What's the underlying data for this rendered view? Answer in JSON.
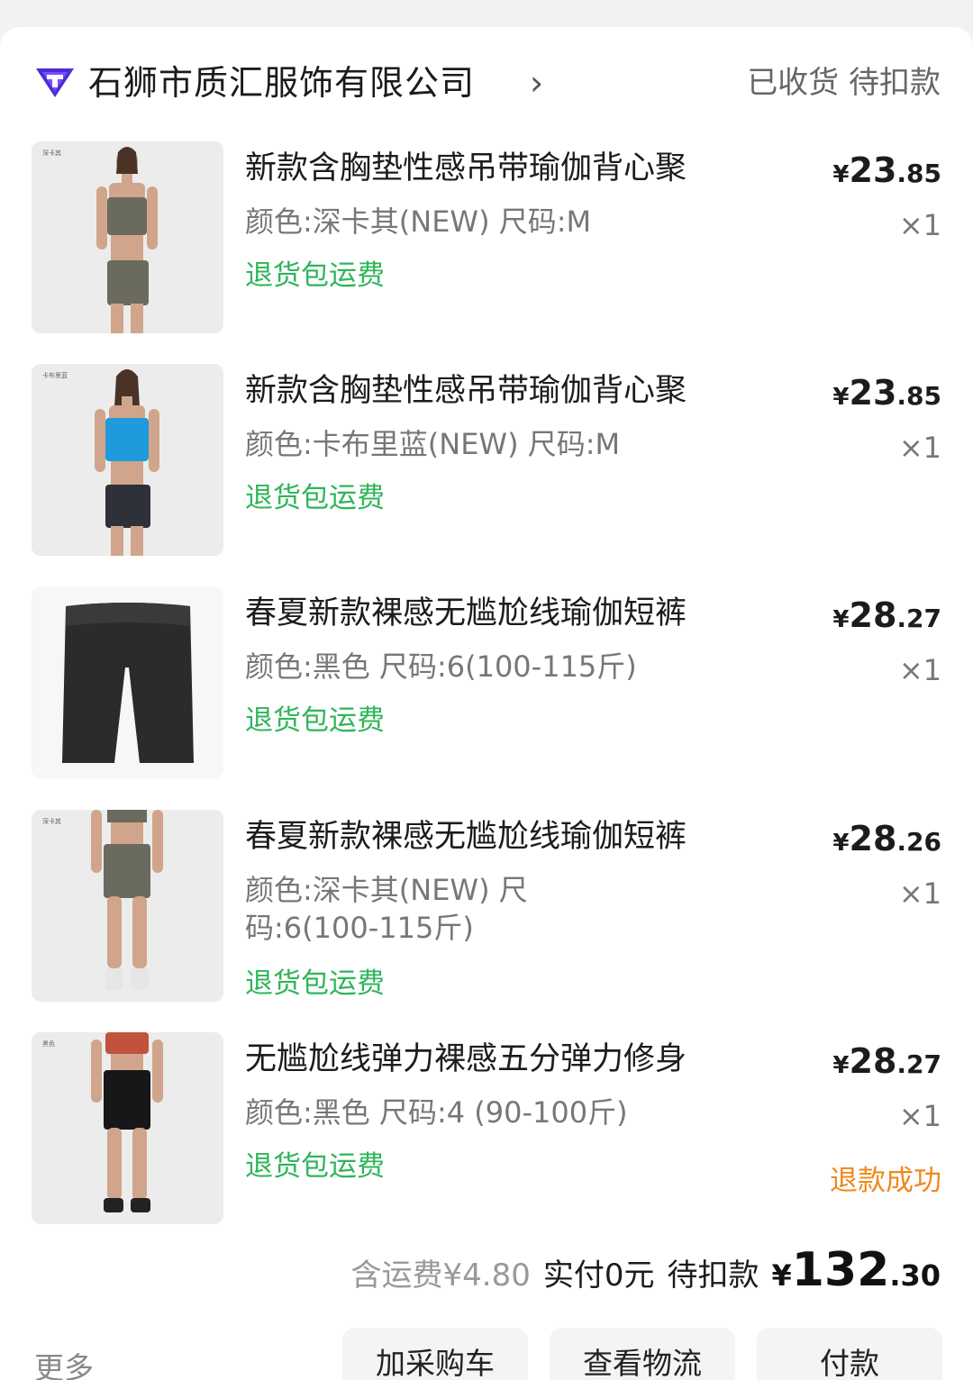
{
  "shop": {
    "name": "石狮市质汇服饰有限公司",
    "status": "已收货 待扣款",
    "brand_color": "#4a2cd6"
  },
  "items": [
    {
      "title": "新款含胸垫性感吊带瑜伽背心聚",
      "spec": "颜色:深卡其(NEW) 尺码:M",
      "tag": "退货包运费",
      "price_cur": "¥",
      "price_int": "23",
      "price_dec": ".85",
      "qty": "×1",
      "thumb_tag": "深卡其"
    },
    {
      "title": "新款含胸垫性感吊带瑜伽背心聚",
      "spec": "颜色:卡布里蓝(NEW) 尺码:M",
      "tag": "退货包运费",
      "price_cur": "¥",
      "price_int": "23",
      "price_dec": ".85",
      "qty": "×1",
      "thumb_tag": "卡布里蓝"
    },
    {
      "title": "春夏新款裸感无尴尬线瑜伽短裤",
      "spec": "颜色:黑色 尺码:6(100-115斤)",
      "tag": "退货包运费",
      "price_cur": "¥",
      "price_int": "28",
      "price_dec": ".27",
      "qty": "×1"
    },
    {
      "title": "春夏新款裸感无尴尬线瑜伽短裤",
      "spec": "颜色:深卡其(NEW) 尺码:6(100-115斤)",
      "tag": "退货包运费",
      "price_cur": "¥",
      "price_int": "28",
      "price_dec": ".26",
      "qty": "×1",
      "thumb_tag": "深卡其"
    },
    {
      "title": "无尴尬线弹力裸感五分弹力修身",
      "spec": "颜色:黑色 尺码:4 (90-100斤)",
      "tag": "退货包运费",
      "price_cur": "¥",
      "price_int": "28",
      "price_dec": ".27",
      "qty": "×1",
      "refund_status": "退款成功",
      "thumb_tag": "黑色"
    }
  ],
  "summary": {
    "shipping": "含运费¥4.80",
    "paid": "实付0元",
    "pending": "待扣款",
    "total_cur": "¥",
    "total_int": "132",
    "total_dec": ".30"
  },
  "footer": {
    "more": "更多",
    "buttons": [
      "加采购车",
      "查看物流",
      "付款"
    ]
  },
  "colors": {
    "green_tag": "#2fb55a",
    "refund_orange": "#f0881c",
    "background": "#f2f2f2"
  }
}
